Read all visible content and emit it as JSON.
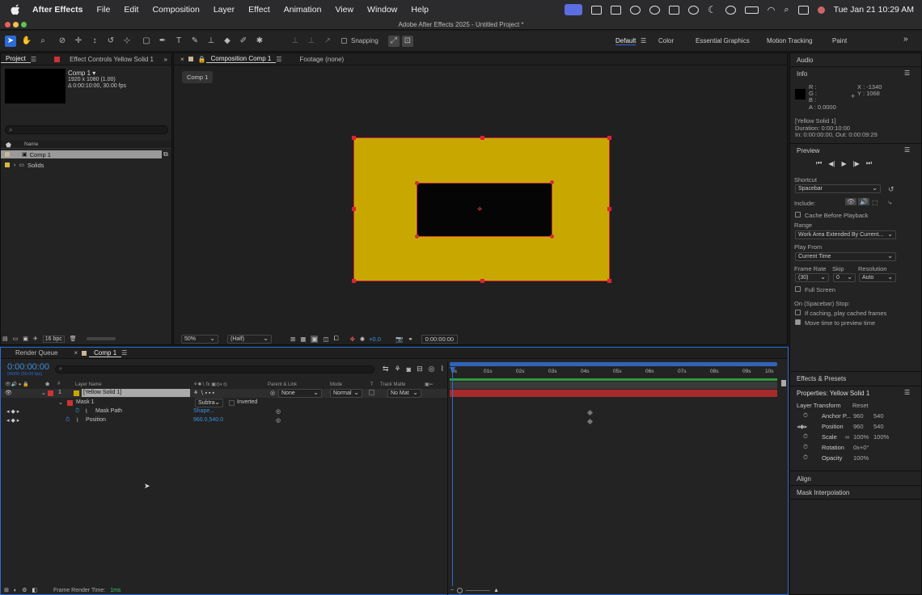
{
  "menubar": {
    "app": "After Effects",
    "items": [
      "File",
      "Edit",
      "Composition",
      "Layer",
      "Effect",
      "Animation",
      "View",
      "Window",
      "Help"
    ],
    "clock": "Tue Jan 21  10:29 AM"
  },
  "window_title": "Adobe After Effects 2025 - Untitled Project *",
  "toolbar": {
    "snapping": "Snapping",
    "workspaces": [
      "Default",
      "Color",
      "Essential Graphics",
      "Motion Tracking",
      "Paint"
    ]
  },
  "project": {
    "tab_project": "Project",
    "tab_effects": "Effect Controls Yellow Solid 1",
    "comp_name": "Comp 1 ▾",
    "comp_res": "1920 x 1080 (1.00)",
    "comp_dur": "Δ 0:00:10:00, 30.00 fps",
    "col_name": "Name",
    "items": [
      "Comp 1",
      "Solids"
    ],
    "bpc": "16 bpc"
  },
  "composition": {
    "tab": "Composition Comp 1",
    "footage": "Footage (none)",
    "breadcrumb": "Comp 1",
    "zoom": "50%",
    "quality": "(Half)",
    "exposure": "+0.0",
    "time": "0:00:00:00"
  },
  "right": {
    "audio": "Audio",
    "info": "Info",
    "info_r": "R :",
    "info_g": "G :",
    "info_b": "B :",
    "info_a": "A : 0.0000",
    "info_x": "X : -1340",
    "info_y": "Y : 1068",
    "layer_name": "[Yellow Solid 1]",
    "duration": "Duration: 0:00:10:00",
    "inout": "In: 0:00:00:00, Out: 0:00:09:29",
    "preview": "Preview",
    "shortcut": "Shortcut",
    "shortcut_val": "Spacebar",
    "include": "Include:",
    "cache": "Cache Before Playback",
    "range": "Range",
    "range_val": "Work Area Extended By Current...",
    "playfrom": "Play From",
    "playfrom_val": "Current Time",
    "framerate": "Frame Rate",
    "skip": "Skip",
    "resolution": "Resolution",
    "fr_val": "(30)",
    "skip_val": "0",
    "res_val": "Auto",
    "fullscreen": "Full Screen",
    "stop": "On (Spacebar) Stop:",
    "ifcaching": "If caching, play cached frames",
    "movetime": "Move time to preview time",
    "effects": "Effects & Presets",
    "properties": "Properties: Yellow Solid 1",
    "layer_transform": "Layer Transform",
    "reset": "Reset",
    "props": [
      {
        "name": "Anchor P...",
        "v1": "960",
        "v2": "540"
      },
      {
        "name": "Position",
        "v1": "960",
        "v2": "540"
      },
      {
        "name": "Scale",
        "v1": "100%",
        "v2": "100%"
      },
      {
        "name": "Rotation",
        "v1": "0x+0°",
        "v2": ""
      },
      {
        "name": "Opacity",
        "v1": "100%",
        "v2": ""
      }
    ],
    "align": "Align",
    "mask_interp": "Mask Interpolation"
  },
  "timeline": {
    "tab_rq": "Render Queue",
    "tab_comp": "Comp 1",
    "timecode": "0:00:00:00",
    "fps": "00000 (30.00 fps)",
    "col_layer": "Layer Name",
    "col_parent": "Parent & Link",
    "col_mode": "Mode",
    "col_t": "T",
    "col_track": "Track Matte",
    "layer_num": "1",
    "layer_name": "[Yellow Solid 1]",
    "parent": "None",
    "mode": "Normal",
    "matte": "No Mat",
    "mask": "Mask 1",
    "mask_mode": "Subtra",
    "inverted": "Inverted",
    "mask_path": "Mask Path",
    "mask_path_val": "Shape...",
    "position": "Position",
    "position_val": "960.0,540.0",
    "ruler": [
      "0s",
      "01s",
      "02s",
      "03s",
      "04s",
      "05s",
      "06s",
      "07s",
      "08s",
      "09s",
      "10s"
    ],
    "frame_render_label": "Frame Render Time:",
    "frame_render_val": "1ms"
  },
  "colors": {
    "accent": "#2d6bd6",
    "solid": "#c8a800",
    "bar": "#a82a2a"
  }
}
